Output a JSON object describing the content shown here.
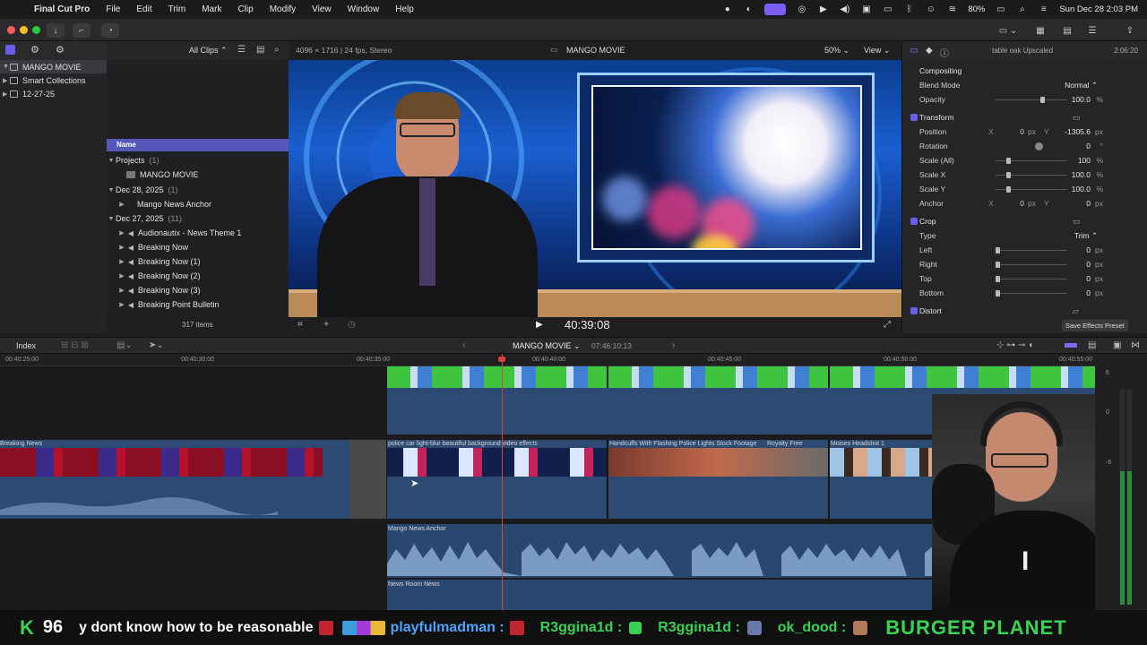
{
  "menubar": {
    "app": "Final Cut Pro",
    "items": [
      "File",
      "Edit",
      "Trim",
      "Mark",
      "Clip",
      "Modify",
      "View",
      "Window",
      "Help"
    ],
    "battery": "80%",
    "datetime": "Sun Dec 28  2:03 PM"
  },
  "library": {
    "items": [
      {
        "label": "MANGO MOVIE",
        "selected": true
      },
      {
        "label": "Smart Collections",
        "selected": false
      },
      {
        "label": "12-27-25",
        "selected": false
      }
    ]
  },
  "browser": {
    "filter": "All Clips",
    "column_header": "Name",
    "count": "317 items",
    "groups": [
      {
        "label": "Projects",
        "count": "(1)",
        "items": [
          "MANGO MOVIE"
        ]
      },
      {
        "label": "Dec 28, 2025",
        "count": "(1)",
        "items": [
          "Mango News Anchor"
        ]
      },
      {
        "label": "Dec 27, 2025",
        "count": "(11)",
        "items": [
          "Audionautix - News Theme 1",
          "Breaking Now",
          "Breaking Now (1)",
          "Breaking Now (2)",
          "Breaking Now (3)",
          "Breaking Point Bulletin"
        ]
      }
    ]
  },
  "viewer": {
    "format": "4096 × 1716 | 24 fps, Stereo",
    "title": "MANGO MOVIE",
    "zoom": "50%",
    "view": "View",
    "timecode": "40:39:08"
  },
  "inspector": {
    "clip_name": "table oak Upscaled",
    "duration": "2:06:20",
    "compositing": "Compositing",
    "blend_mode_label": "Blend Mode",
    "blend_mode_value": "Normal",
    "opacity_label": "Opacity",
    "opacity_value": "100.0",
    "transform": "Transform",
    "position_label": "Position",
    "position_x": "0",
    "position_y": "-1305.6",
    "rotation_label": "Rotation",
    "rotation_value": "0",
    "scale_all_label": "Scale (All)",
    "scale_all_value": "100",
    "scale_x_label": "Scale X",
    "scale_x_value": "100.0",
    "scale_y_label": "Scale Y",
    "scale_y_value": "100.0",
    "anchor_label": "Anchor",
    "anchor_x": "0",
    "anchor_y": "0",
    "crop": "Crop",
    "type_label": "Type",
    "type_value": "Trim",
    "left_label": "Left",
    "left_value": "0",
    "right_label": "Right",
    "right_value": "0",
    "top_label": "Top",
    "top_value": "0",
    "bottom_label": "Bottom",
    "bottom_value": "0",
    "distort": "Distort",
    "save_preset": "Save Effects Preset",
    "units": {
      "px": "px",
      "pct": "%",
      "deg": "°"
    }
  },
  "timeline": {
    "index": "Index",
    "project": "MANGO MOVIE",
    "duration": "07:46:10:13",
    "ruler": [
      "00:40:25:00",
      "00:40:30:00",
      "00:40:35:00",
      "00:40:40:00",
      "00:40:45:00",
      "00:40:50:00",
      "00:40:55:00"
    ],
    "clips": {
      "breaking_news": "Breaking News",
      "police": "police car light-blur beautiful background video effects",
      "handcuffs": "Handcuffs With Flashing Police Lights Stock Footage",
      "royalty": "Royalty Free",
      "moises": "Moises Headshot 1",
      "anchor": "Mango News Anchor",
      "newsroom": "News Room News"
    },
    "meter_labels": [
      "6",
      "0",
      "-6"
    ]
  },
  "ticker": {
    "count": "96",
    "message": "y dont know how to be reasonable",
    "users": [
      "playfulmadman :",
      "R3ggina1d :",
      "R3ggina1d :",
      "ok_dood :"
    ],
    "brand": "BURGER PLANET"
  },
  "colors": {
    "accent": "#7b5cf0",
    "green_screen": "#3ec43e",
    "clip_blue": "#2d4a73",
    "ticker_green": "#39d353",
    "playhead": "#d94040"
  }
}
